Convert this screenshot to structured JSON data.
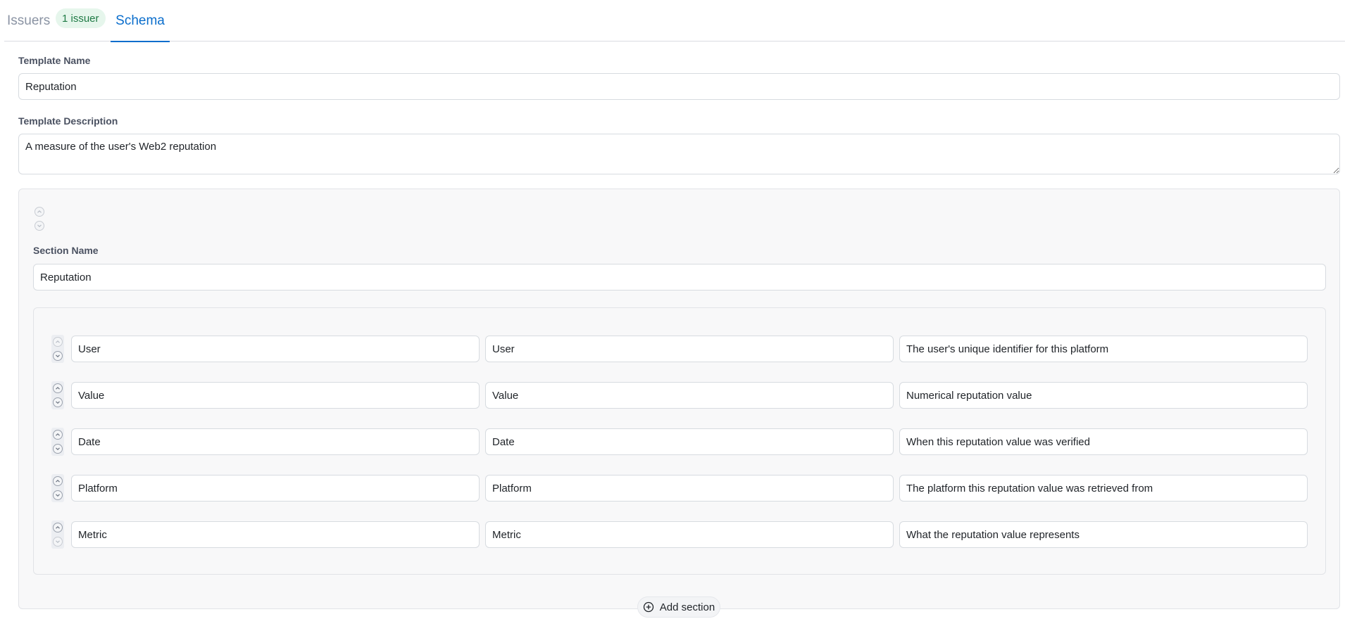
{
  "tabs": {
    "issuers_label": "Issuers",
    "issuers_badge": "1 issuer",
    "schema_label": "Schema",
    "active": "Schema"
  },
  "template": {
    "name_label": "Template Name",
    "name_value": "Reputation",
    "description_label": "Template Description",
    "description_value": "A measure of the user's Web2 reputation"
  },
  "section": {
    "name_label": "Section Name",
    "name_value": "Reputation",
    "fields": [
      {
        "name": "User",
        "type": "User",
        "description": "The user's unique identifier for this platform"
      },
      {
        "name": "Value",
        "type": "Value",
        "description": "Numerical reputation value"
      },
      {
        "name": "Date",
        "type": "Date",
        "description": "When this reputation value was verified"
      },
      {
        "name": "Platform",
        "type": "Platform",
        "description": "The platform this reputation value was retrieved from"
      },
      {
        "name": "Metric",
        "type": "Metric",
        "description": "What the reputation value represents"
      }
    ]
  },
  "actions": {
    "add_section_label": "Add section"
  },
  "icons": {
    "move_up": "chevron-up-circle-icon",
    "move_down": "chevron-down-circle-icon",
    "add": "plus-circle-icon"
  },
  "colors": {
    "accent": "#0b6ecc",
    "badge_bg": "#e6f6ec",
    "badge_text": "#1f7a45",
    "muted_tab": "#8a93a3"
  }
}
